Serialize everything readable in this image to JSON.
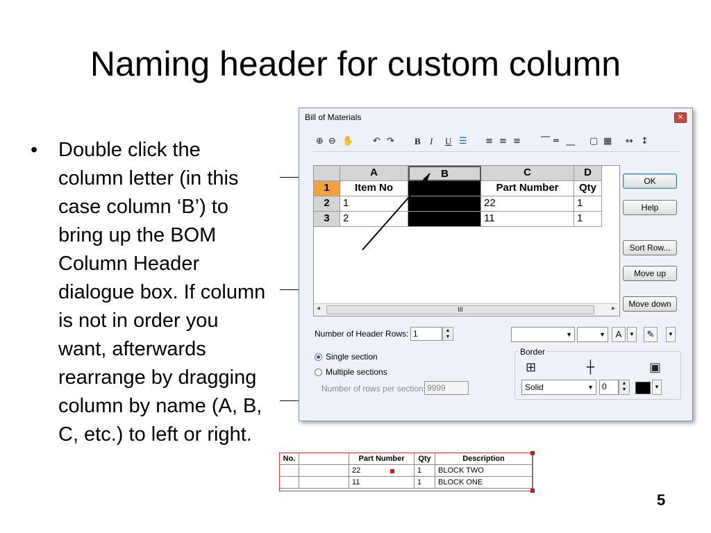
{
  "slide": {
    "title": "Naming header for custom column",
    "bullet_char": "•",
    "bullet_text": "Double click the column letter (in this case column ‘B’) to bring up the BOM Column Header dialogue box. If column is not in order you want, afterwards rearrange by dragging column by name (A, B, C, etc.) to left or right.",
    "page_number": "5"
  },
  "dialog": {
    "title": "Bill of Materials",
    "close_glyph": "✕",
    "toolbar": {
      "zoom_in": "⊕",
      "zoom_out": "⊖",
      "pan": "✋",
      "undo": "↶",
      "redo": "↷",
      "bold": "B",
      "italic": "I",
      "underline": "U",
      "strikethrough": "☰",
      "align_left": "≡",
      "align_center": "≡",
      "align_right": "≡",
      "valign_top": "⎺",
      "valign_middle": "═",
      "valign_bottom": "⎽",
      "border_outline": "▢",
      "grid": "▦",
      "col_width": "↔",
      "row_height": "↕"
    },
    "sheet": {
      "columns": [
        "A",
        "B",
        "C",
        "D"
      ],
      "rows": [
        {
          "num": "1",
          "cells": [
            "Item No",
            "",
            "Part Number",
            "Qty"
          ]
        },
        {
          "num": "2",
          "cells": [
            "1",
            "",
            "22",
            "1"
          ]
        },
        {
          "num": "3",
          "cells": [
            "2",
            "",
            "11",
            "1"
          ]
        }
      ],
      "scroll_left": "◂",
      "scroll_right": "▸",
      "scroll_grip": "III"
    },
    "buttons": {
      "ok": "OK",
      "help": "Help",
      "sort_row": "Sort Row...",
      "move_up": "Move up",
      "move_down": "Move down"
    },
    "header_rows_label": "Number of Header Rows:",
    "header_rows_value": "1",
    "spin_up": "▲",
    "spin_down": "▼",
    "combo_arrow": "▼",
    "single_section_label": "Single section",
    "multiple_sections_label": "Multiple sections",
    "rows_per_section_label": "Number of rows per section:",
    "rows_per_section_value": "9999",
    "font_color_glyph": "A",
    "fill_color_glyph": "✎",
    "border_group_label": "Border",
    "border_all_glyph": "⊞",
    "border_inner_glyph": "┼",
    "border_outer_glyph": "▣",
    "line_style_value": "Solid",
    "line_width_value": "0",
    "accent_blue": "#1f5fa8",
    "header_highlight": "#f2a23c"
  },
  "bom_table": {
    "headers": [
      "No.",
      "",
      "Part Number",
      "Qty",
      "Description"
    ],
    "rows": [
      [
        "",
        "",
        "22",
        "1",
        "BLOCK TWO"
      ],
      [
        "",
        "",
        "11",
        "1",
        "BLOCK ONE"
      ]
    ]
  }
}
